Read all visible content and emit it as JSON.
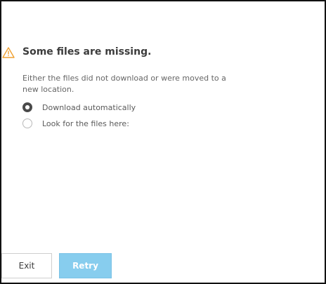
{
  "dialog": {
    "title": "Some files are missing.",
    "message": "Either the files did not download or were moved to a new location.",
    "warning_icon": "warning-triangle-icon",
    "warning_color": "#f0a030"
  },
  "options": [
    {
      "label": "Download automatically",
      "selected": true
    },
    {
      "label": "Look for the files here:",
      "selected": false
    }
  ],
  "buttons": {
    "exit_label": "Exit",
    "retry_label": "Retry",
    "retry_color": "#87cdee"
  }
}
